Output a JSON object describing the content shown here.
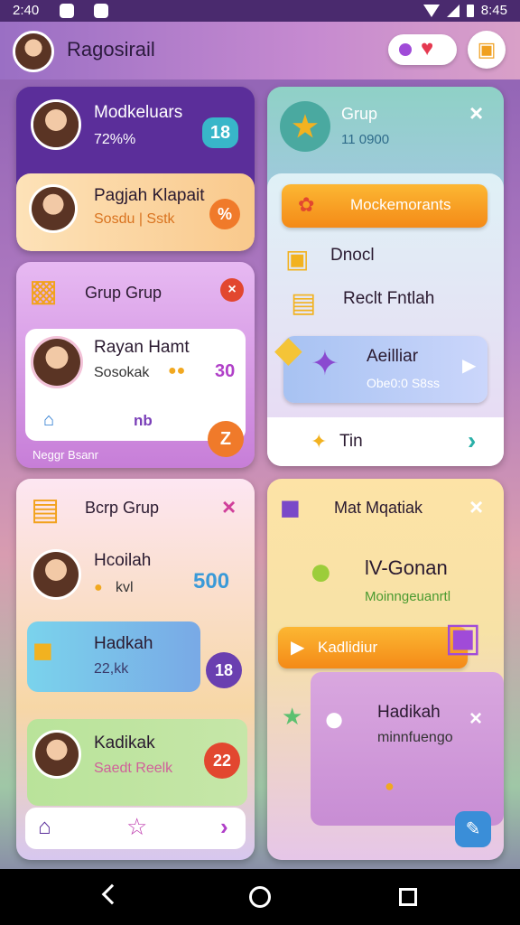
{
  "status": {
    "time": "2:40",
    "right": "8:45"
  },
  "header": {
    "title": "Ragosirail"
  },
  "colors": {
    "accent": "#7a3fb8",
    "badge_teal": "#38b6c9",
    "badge_orange": "#f07a2a",
    "badge_red": "#e2472f",
    "orange_btn": "#f8a31a"
  },
  "left_top": {
    "name": "Modkeluars",
    "sub": "72%%",
    "badge": "18"
  },
  "left_second": {
    "name": "Pagjah Klapait",
    "sub": "Sosdu | Sstk",
    "badge": "%"
  },
  "left_group": {
    "title": "Grup Grup",
    "person": "Rayan Hamt",
    "sub": "Sosokak",
    "score": "30",
    "tab_label": "nb",
    "footer": "Neggr Bsanr",
    "badge": "Z"
  },
  "left_bottom": {
    "title": "Bcrp Grup",
    "item1": {
      "name": "Hcoilah",
      "sub": "kvl",
      "value": "500"
    },
    "item2": {
      "name": "Hadkah",
      "sub": "22,kk",
      "badge": "18"
    },
    "item3": {
      "name": "Kadikak",
      "sub": "Saedt Reelk",
      "badge": "22"
    }
  },
  "right_top": {
    "title": "Grup",
    "sub": "11 0900",
    "button": "Mockemorants",
    "item1": "Dnocl",
    "item2": "Reclt Fntlah",
    "feature_title": "Aeilliar",
    "feature_sub": "Obe0:0 S8ss",
    "footer": "Tin"
  },
  "right_bottom": {
    "title": "Mat Mqatiak",
    "item_title": "lV-Gonan",
    "item_sub": "Moinngeuanrtl",
    "button": "Kadlidiur",
    "card_title": "Hadikah",
    "card_sub": "minnfuengo"
  }
}
